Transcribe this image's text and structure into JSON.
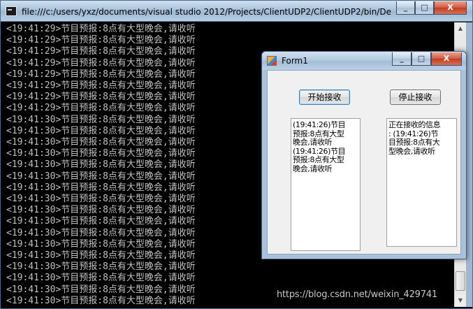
{
  "console": {
    "title": "file:///c:/users/yxz/documents/visual studio 2012/Projects/ClientUDP2/ClientUDP2/bin/De...",
    "lines": [
      "<19:41:29>节目预报:8点有大型晚会,请收听",
      "<19:41:29>节目预报:8点有大型晚会,请收听",
      "<19:41:29>节目预报:8点有大型晚会,请收听",
      "<19:41:29>节目预报:8点有大型晚会,请收听",
      "<19:41:29>节目预报:8点有大型晚会,请收听",
      "<19:41:29>节目预报:8点有大型晚会,请收听",
      "<19:41:29>节目预报:8点有大型晚会,请收听",
      "<19:41:29>节目预报:8点有大型晚会,请收听",
      "<19:41:30>节目预报:8点有大型晚会,请收听",
      "<19:41:30>节目预报:8点有大型晚会,请收听",
      "<19:41:30>节目预报:8点有大型晚会,请收听",
      "<19:41:30>节目预报:8点有大型晚会,请收听",
      "<19:41:30>节目预报:8点有大型晚会,请收听",
      "<19:41:30>节目预报:8点有大型晚会,请收听",
      "<19:41:30>节目预报:8点有大型晚会,请收听",
      "<19:41:30>节目预报:8点有大型晚会,请收听",
      "<19:41:30>节目预报:8点有大型晚会,请收听",
      "<19:41:30>节目预报:8点有大型晚会,请收听",
      "<19:41:30>节目预报:8点有大型晚会,请收听",
      "<19:41:30>节目预报:8点有大型晚会,请收听",
      "<19:41:30>节目预报:8点有大型晚会,请收听",
      "<19:41:30>节目预报:8点有大型晚会,请收听",
      "<19:41:30>节目预报:8点有大型晚会,请收听",
      "<19:41:30>节目预报:8点有大型晚会,请收听",
      "<19:41:30>节目预报:8点有大型晚会,请收听"
    ],
    "buttons": {
      "minimize": "_",
      "maximize": "□",
      "close": "X"
    },
    "scroll": {
      "up": "▲",
      "down": "▼"
    }
  },
  "form": {
    "title": "Form1",
    "buttons": {
      "minimize": "_",
      "maximize": "□",
      "close": "X"
    },
    "start_label": "开始接收",
    "stop_label": "停止接收",
    "left_list": [
      "(19:41:26)节目",
      "预报:8点有大型",
      "晚会,请收听",
      "(19:41:26)节目",
      "预报:8点有大型",
      "晚会,请收听"
    ],
    "right_list": [
      "正在接收的信息",
      ": (19:41:26)节",
      "目预报:8点有大",
      "型晚会,请收听"
    ]
  },
  "watermark": "https://blog.csdn.net/weixin_429741"
}
